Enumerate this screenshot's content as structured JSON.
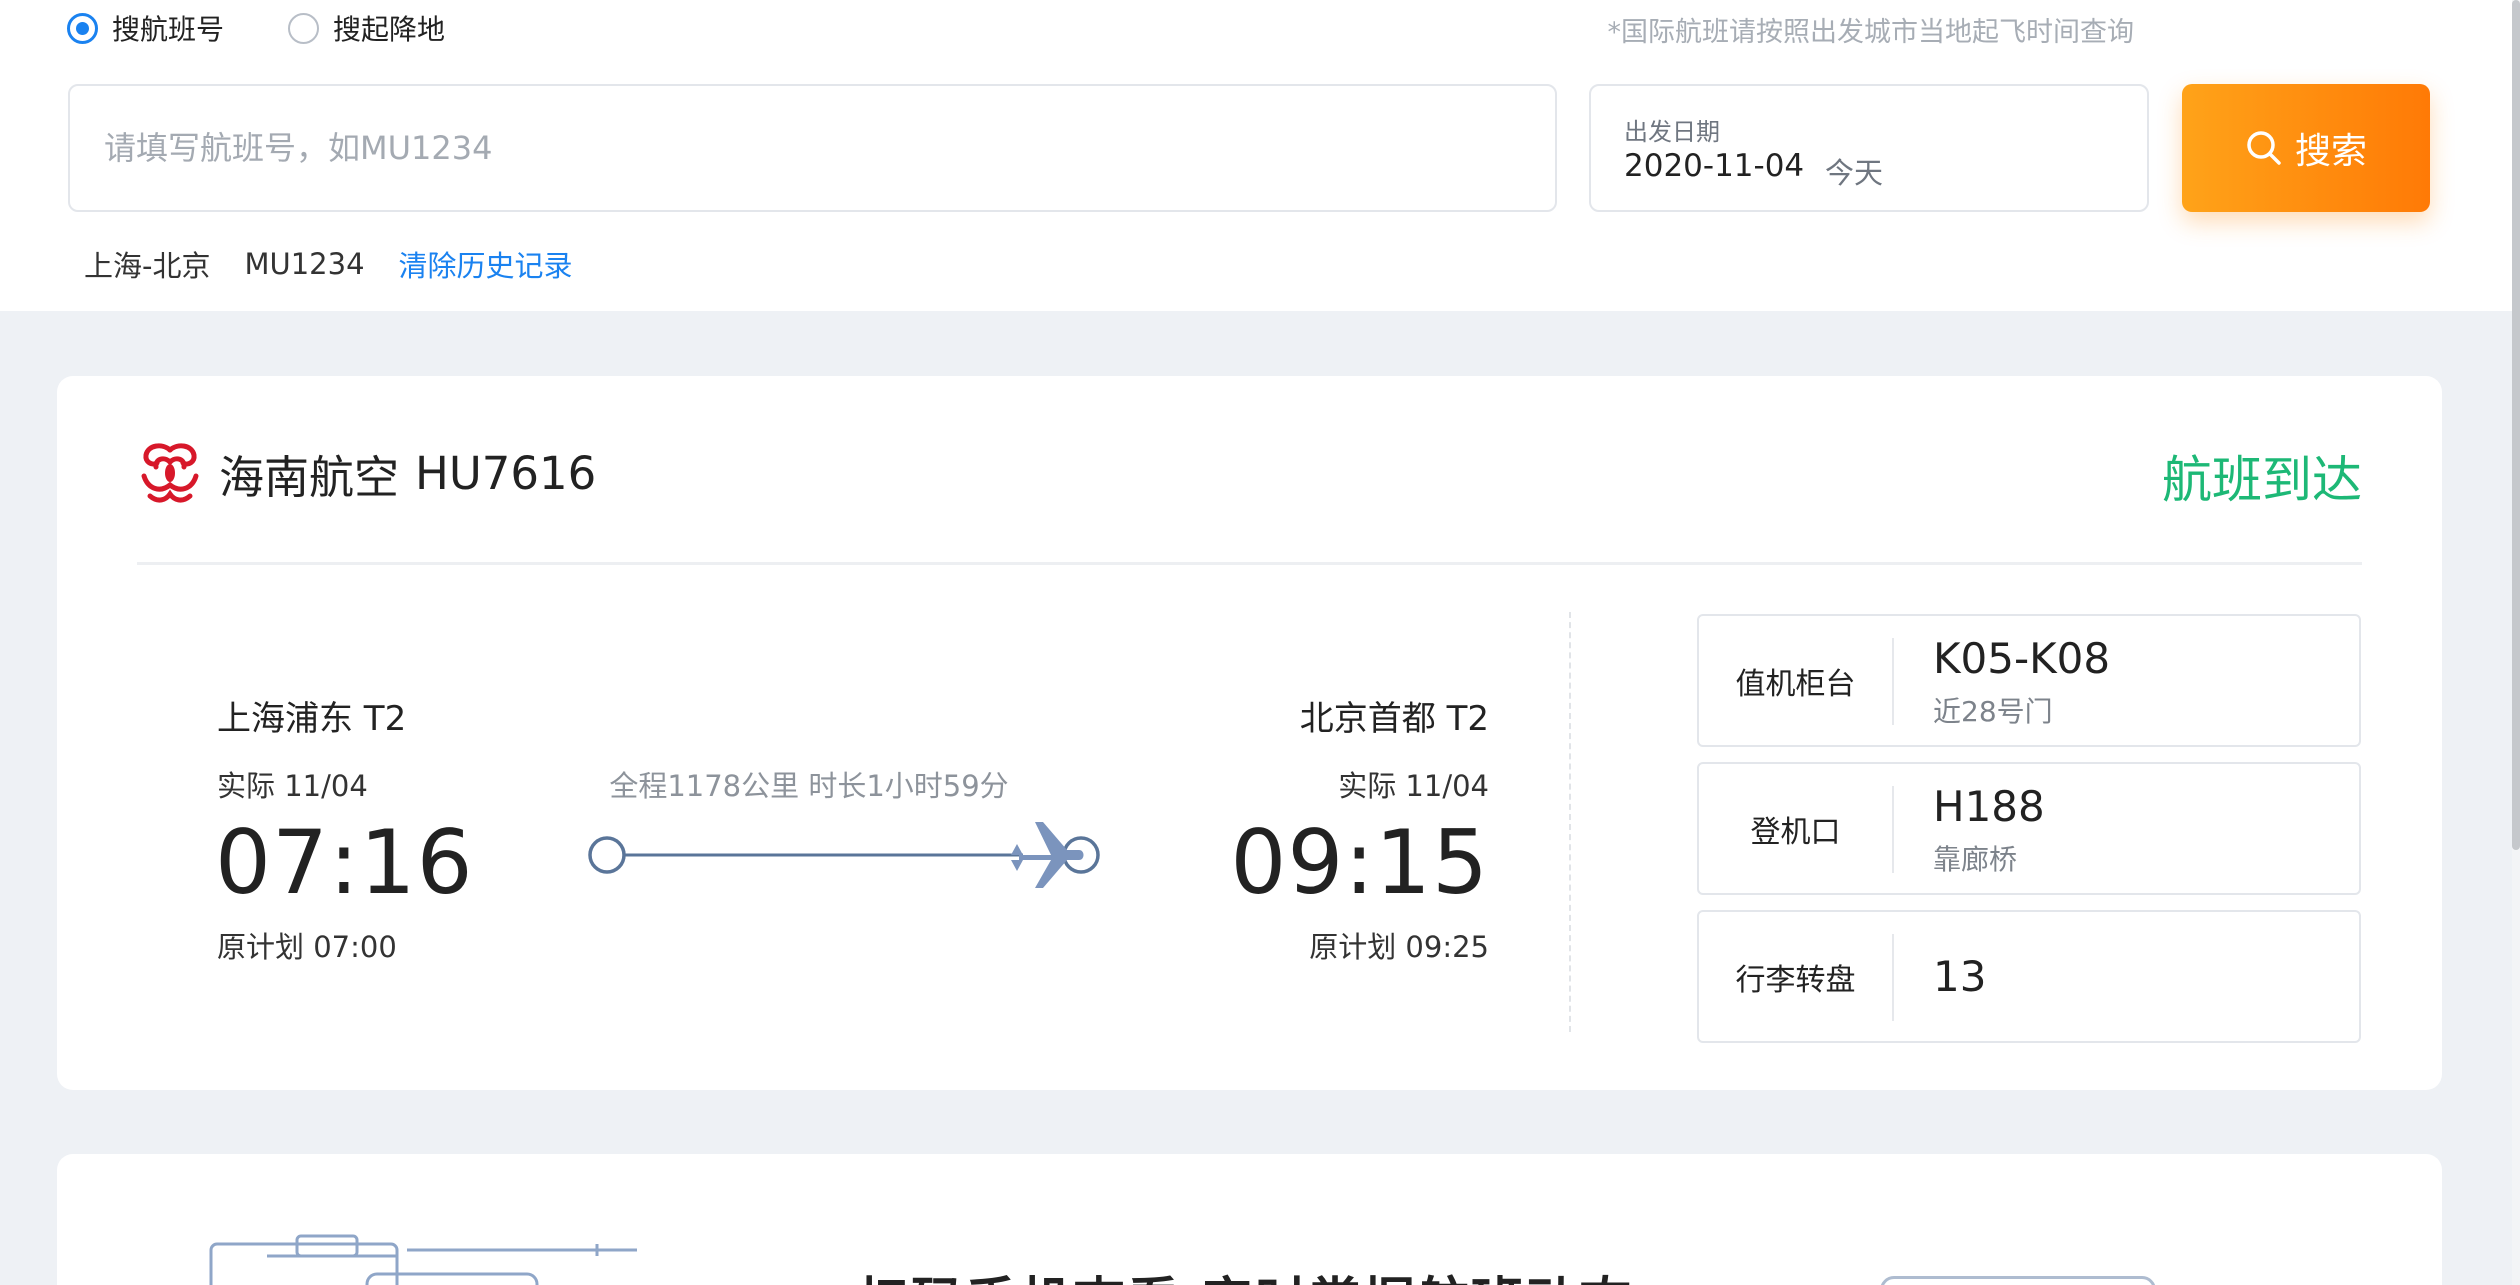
{
  "search": {
    "modes": [
      {
        "label": "搜航班号",
        "checked": true
      },
      {
        "label": "搜起降地",
        "checked": false
      }
    ],
    "intl_note": "*国际航班请按照出发城市当地起飞时间查询",
    "flight_input": {
      "placeholder": "请填写航班号，如MU1234",
      "value": ""
    },
    "date": {
      "label": "出发日期",
      "value": "2020-11-04",
      "relative": "今天"
    },
    "button_label": "搜索",
    "history": [
      "上海-北京",
      "MU1234"
    ],
    "clear_history": "清除历史记录"
  },
  "flight": {
    "airline": "海南航空",
    "flight_no": "HU7616",
    "status": "航班到达",
    "status_color": "#1db876",
    "departure": {
      "airport": "上海浦东 T2",
      "actual_label": "实际 11/04",
      "time": "07:16",
      "planned": "原计划 07:00"
    },
    "arrival": {
      "airport": "北京首都 T2",
      "actual_label": "实际 11/04",
      "time": "09:15",
      "planned": "原计划 09:25"
    },
    "route_info": "全程1178公里 时长1小时59分",
    "details": [
      {
        "label": "值机柜台",
        "value": "K05-K08",
        "sub": "近28号门"
      },
      {
        "label": "登机口",
        "value": "H188",
        "sub": "靠廊桥"
      },
      {
        "label": "行李转盘",
        "value": "13",
        "sub": ""
      }
    ]
  },
  "promo": {
    "title": "扫码手机查看 实时掌握航班动态"
  },
  "colors": {
    "accent_blue": "#1a82f0",
    "search_orange": "#ff8a0d",
    "arrived_green": "#1db876",
    "airline_red": "#d7182a"
  }
}
